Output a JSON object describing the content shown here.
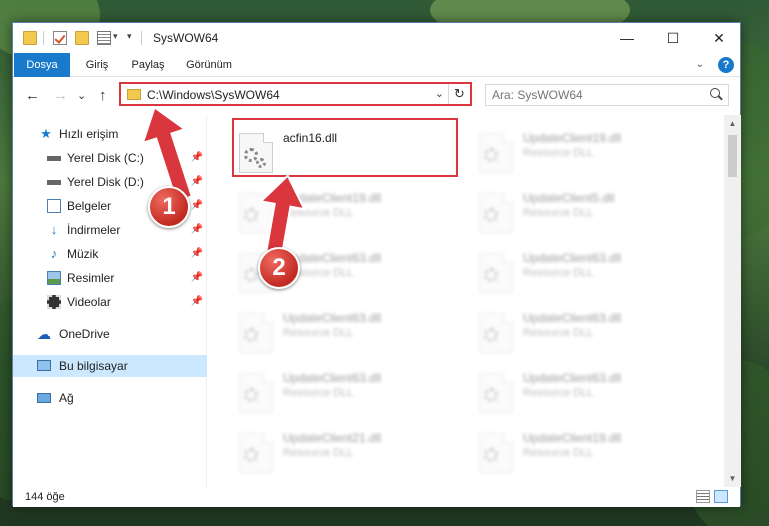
{
  "window": {
    "title": "SysWOW64",
    "minimize_glyph": "—",
    "maximize_glyph": "☐",
    "close_glyph": "✕"
  },
  "ribbon": {
    "tabs": [
      "Dosya",
      "Giriş",
      "Paylaş",
      "Görünüm"
    ],
    "help_glyph": "?"
  },
  "nav": {
    "back_glyph": "←",
    "forward_glyph": "→",
    "recent_glyph": "⌄",
    "up_glyph": "↑",
    "address": "C:\\Windows\\SysWOW64",
    "refresh_glyph": "↻",
    "search_placeholder": "Ara: SysWOW64"
  },
  "sidebar": {
    "items": [
      {
        "label": "Hızlı erişim",
        "icon": "star-icon"
      },
      {
        "label": "Yerel Disk (C:)",
        "icon": "drive-icon"
      },
      {
        "label": "Yerel Disk (D:)",
        "icon": "drive-icon"
      },
      {
        "label": "Belgeler",
        "icon": "documents-icon"
      },
      {
        "label": "İndirmeler",
        "icon": "download-icon"
      },
      {
        "label": "Müzik",
        "icon": "music-icon"
      },
      {
        "label": "Resimler",
        "icon": "pictures-icon"
      },
      {
        "label": "Videolar",
        "icon": "video-icon"
      },
      {
        "label": "OneDrive",
        "icon": "cloud-icon"
      },
      {
        "label": "Bu bilgisayar",
        "icon": "computer-icon"
      },
      {
        "label": "Ağ",
        "icon": "network-icon"
      }
    ],
    "selected": "Bu bilgisayar"
  },
  "files": [
    {
      "name": "acfin16.dll",
      "type": "",
      "focus": true
    },
    {
      "name": "UpdateClient19.dll",
      "type": "Resource DLL"
    },
    {
      "name": "UpdateClient19.dll",
      "type": "Resource DLL"
    },
    {
      "name": "UpdateClient5.dll",
      "type": "Resource DLL"
    },
    {
      "name": "UpdateClient63.dll",
      "type": "Resource DLL"
    },
    {
      "name": "UpdateClient63.dll",
      "type": "Resource DLL"
    },
    {
      "name": "UpdateClient63.dll",
      "type": "Resource DLL"
    },
    {
      "name": "UpdateClient63.dll",
      "type": "Resource DLL"
    },
    {
      "name": "UpdateClient63.dll",
      "type": "Resource DLL"
    },
    {
      "name": "UpdateClient63.dll",
      "type": "Resource DLL"
    },
    {
      "name": "UpdateClient21.dll",
      "type": "Resource DLL"
    },
    {
      "name": "UpdateClient19.dll",
      "type": "Resource DLL"
    }
  ],
  "status": {
    "item_count": "144 öğe"
  },
  "callouts": {
    "badge_1": "1",
    "badge_2": "2",
    "color": "#d9363e"
  },
  "colors": {
    "accent": "#1979ca",
    "selection": "#cce8ff"
  }
}
